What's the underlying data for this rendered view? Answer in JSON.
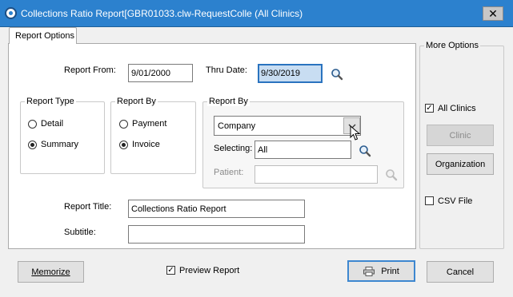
{
  "window": {
    "title": "Collections Ratio Report[GBR01033.clw-RequestColle (All Clinics)",
    "close_glyph": "✕"
  },
  "tab": {
    "label": "Report Options"
  },
  "report_from": {
    "label": "Report From:",
    "value": "9/01/2000"
  },
  "thru_date": {
    "label": "Thru Date:",
    "value": "9/30/2019"
  },
  "report_type": {
    "legend": "Report Type",
    "options": [
      {
        "label": "Detail",
        "selected": false
      },
      {
        "label": "Summary",
        "selected": true
      }
    ]
  },
  "report_by_radio": {
    "legend": "Report By",
    "options": [
      {
        "label": "Payment",
        "selected": false
      },
      {
        "label": "Invoice",
        "selected": true
      }
    ]
  },
  "report_by_select": {
    "legend": "Report By",
    "value": "Company",
    "selecting_label": "Selecting:",
    "selecting_value": "All",
    "patient_label": "Patient:",
    "patient_value": ""
  },
  "report_title": {
    "label": "Report Title:",
    "value": "Collections Ratio Report"
  },
  "subtitle": {
    "label": "Subtitle:",
    "value": ""
  },
  "more_options": {
    "legend": "More Options",
    "all_clinics": {
      "label": "All Clinics",
      "checked": true
    },
    "clinic_button": "Clinic",
    "organization_button": "Organization",
    "csv_file": {
      "label": "CSV File",
      "checked": false
    }
  },
  "footer": {
    "memorize_button": "Memorize",
    "preview_report": {
      "label": "Preview Report",
      "checked": true
    },
    "print_button": "Print",
    "cancel_button": "Cancel"
  },
  "check_glyph": "✓",
  "colors": {
    "titlebar": "#2c81ce",
    "focus_border": "#2a73bf",
    "focus_fill": "#c8ddf2"
  }
}
